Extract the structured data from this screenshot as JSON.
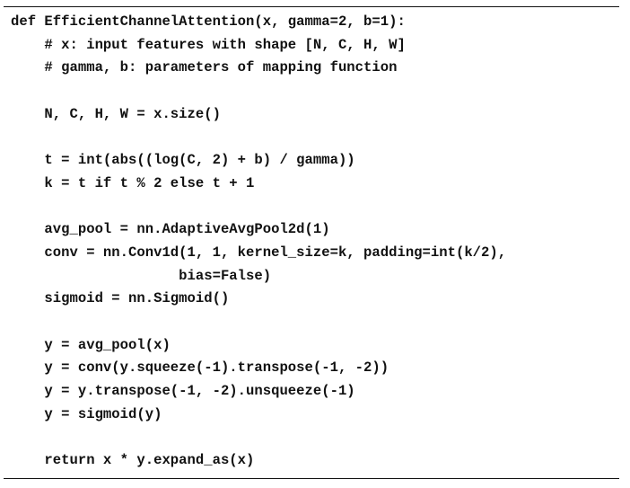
{
  "code": {
    "lines": [
      "def EfficientChannelAttention(x, gamma=2, b=1):",
      "    # x: input features with shape [N, C, H, W]",
      "    # gamma, b: parameters of mapping function",
      "",
      "    N, C, H, W = x.size()",
      "",
      "    t = int(abs((log(C, 2) + b) / gamma))",
      "    k = t if t % 2 else t + 1",
      "",
      "    avg_pool = nn.AdaptiveAvgPool2d(1)",
      "    conv = nn.Conv1d(1, 1, kernel_size=k, padding=int(k/2),",
      "                    bias=False)",
      "    sigmoid = nn.Sigmoid()",
      "",
      "    y = avg_pool(x)",
      "    y = conv(y.squeeze(-1).transpose(-1, -2))",
      "    y = y.transpose(-1, -2).unsqueeze(-1)",
      "    y = sigmoid(y)",
      "",
      "    return x * y.expand_as(x)"
    ]
  }
}
